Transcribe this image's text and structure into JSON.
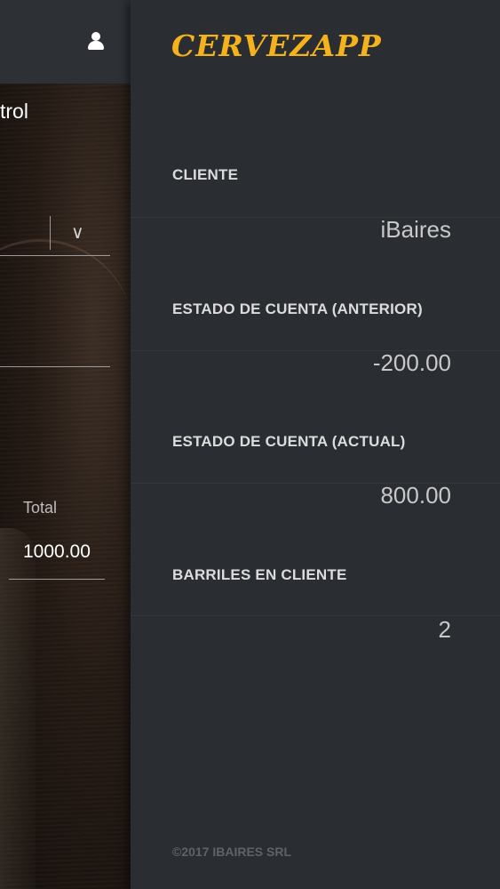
{
  "main": {
    "title_partial": "trol",
    "select_chevron": "∨",
    "total_label": "Total",
    "total_value": "1000.00"
  },
  "drawer": {
    "brand": "CERVEZAPP",
    "items": [
      {
        "label": "CLIENTE",
        "value": "iBaires"
      },
      {
        "label": "ESTADO DE CUENTA (ANTERIOR)",
        "value": "-200.00"
      },
      {
        "label": "ESTADO DE CUENTA (ACTUAL)",
        "value": "800.00"
      },
      {
        "label": "BARRILES EN CLIENTE",
        "value": "2"
      }
    ],
    "footer": "©2017 IBAIRES SRL"
  },
  "icons": {
    "user": "user-icon"
  },
  "colors": {
    "brand": "#f5b21b",
    "drawer_bg": "#2a2d31",
    "topbar_bg": "#2d3136"
  }
}
